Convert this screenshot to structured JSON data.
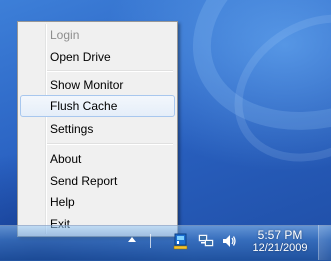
{
  "context_menu": {
    "items": [
      {
        "label": "Login",
        "enabled": false
      },
      {
        "label": "Open Drive",
        "enabled": true
      },
      {
        "label": "Show Monitor",
        "enabled": true
      },
      {
        "label": "Flush Cache",
        "enabled": true,
        "highlighted": true
      },
      {
        "label": "Settings",
        "enabled": true
      },
      {
        "label": "About",
        "enabled": true
      },
      {
        "label": "Send Report",
        "enabled": true
      },
      {
        "label": "Help",
        "enabled": true
      },
      {
        "label": "Exit",
        "enabled": true
      }
    ]
  },
  "taskbar": {
    "clock_time": "5:57 PM",
    "clock_date": "12/21/2009",
    "tray_icons": [
      "show-hidden-icons-arrow",
      "app-tray-icon",
      "network-icon",
      "volume-icon"
    ]
  },
  "colors": {
    "menu_background": "#f0f0f0",
    "highlight_border": "#a8c7ee",
    "disabled_text": "#8d8d8d",
    "desktop_blue": "#2a62c2"
  }
}
